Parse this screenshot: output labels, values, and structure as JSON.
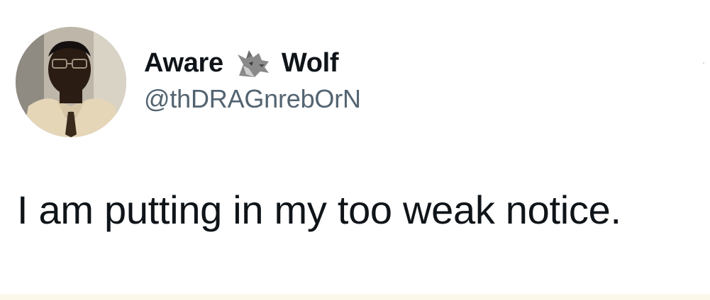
{
  "author": {
    "name_first": "Aware",
    "name_emoji": "wolf-icon",
    "name_last": "Wolf",
    "handle": "@thDRAGnrebOrN",
    "avatar": "profile-photo"
  },
  "tweet": {
    "text": "I am putting in my too weak notice."
  },
  "colors": {
    "background": "#ffffff",
    "text_primary": "#0f1419",
    "text_secondary": "#536471"
  }
}
